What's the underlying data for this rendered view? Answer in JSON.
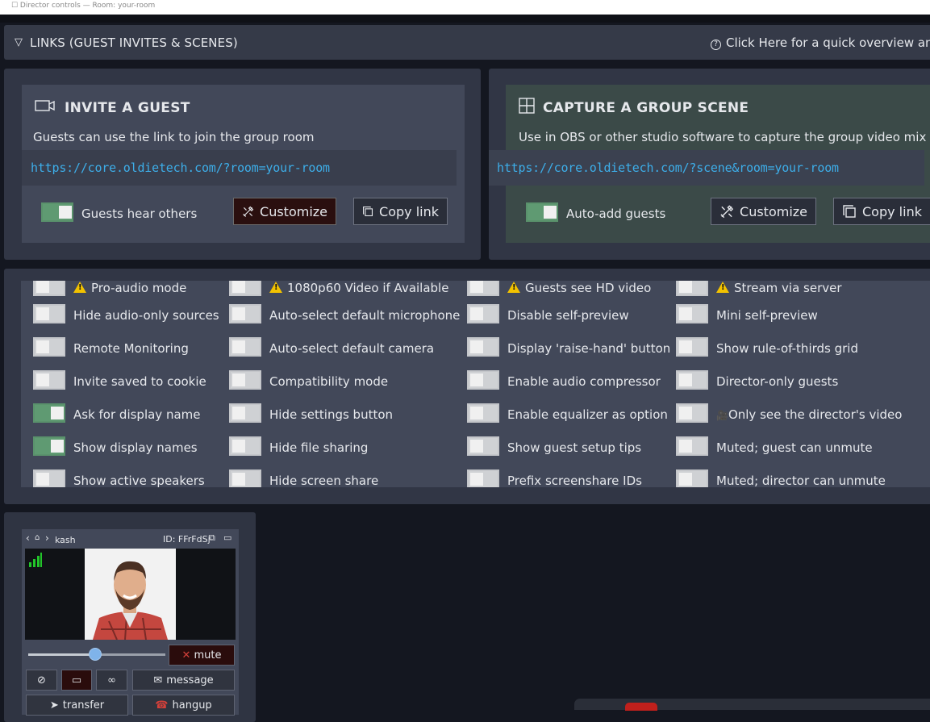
{
  "topbar": {
    "text": "☐ Director controls — Room: your-room"
  },
  "links_header": {
    "title": "LINKS (GUEST INVITES & SCENES)",
    "help": "Click Here for a quick overview and"
  },
  "guest": {
    "title": "INVITE A GUEST",
    "desc": "Guests can use the link to join the group room",
    "url": "https://core.oldietech.com/?room=your-room",
    "toggle_label": "Guests hear others",
    "customize": "Customize",
    "copy": "Copy link"
  },
  "scene": {
    "title": "CAPTURE A GROUP SCENE",
    "desc": "Use in OBS or other studio software to capture the group video mix",
    "url": "https://core.oldietech.com/?scene&room=your-room",
    "toggle_label": "Auto-add guests",
    "customize": "Customize",
    "copy": "Copy link"
  },
  "options": {
    "col1": [
      {
        "label": "Pro-audio mode",
        "on": false,
        "warn": true
      },
      {
        "label": "Hide audio-only sources",
        "on": false
      },
      {
        "label": "Remote Monitoring",
        "on": false
      },
      {
        "label": "Invite saved to cookie",
        "on": false
      },
      {
        "label": "Ask for display name",
        "on": true
      },
      {
        "label": "Show display names",
        "on": true
      },
      {
        "label": "Show active speakers",
        "on": false
      }
    ],
    "col2": [
      {
        "label": "1080p60 Video if Available",
        "on": false,
        "warn": true
      },
      {
        "label": "Auto-select default microphone",
        "on": false
      },
      {
        "label": "Auto-select default camera",
        "on": false
      },
      {
        "label": "Compatibility mode",
        "on": false
      },
      {
        "label": "Hide settings button",
        "on": false
      },
      {
        "label": "Hide file sharing",
        "on": false
      },
      {
        "label": "Hide screen share",
        "on": false
      }
    ],
    "col3": [
      {
        "label": "Guests see HD video",
        "on": false,
        "warn": true
      },
      {
        "label": "Disable self-preview",
        "on": false
      },
      {
        "label": "Display 'raise-hand' button",
        "on": false
      },
      {
        "label": "Enable audio compressor",
        "on": false
      },
      {
        "label": "Enable equalizer as option",
        "on": false
      },
      {
        "label": "Show guest setup tips",
        "on": false
      },
      {
        "label": "Prefix screenshare IDs",
        "on": false
      }
    ],
    "col4": [
      {
        "label": "Stream via server",
        "on": false,
        "warn": true
      },
      {
        "label": "Mini self-preview",
        "on": false
      },
      {
        "label": "Show rule-of-thirds grid",
        "on": false
      },
      {
        "label": "Director-only guests",
        "on": false
      },
      {
        "label": "Only see the director's video",
        "on": false,
        "icon": true
      },
      {
        "label": "Muted; guest can unmute",
        "on": false
      },
      {
        "label": "Muted; director can unmute",
        "on": false
      }
    ]
  },
  "video_card": {
    "name": "kash",
    "id": "ID: FFrFdSj",
    "mute": "mute",
    "message": "message",
    "transfer": "transfer",
    "hangup": "hangup"
  },
  "colors": {
    "accent_link": "#3daee9",
    "toggle_on": "#5f9a72",
    "warning": "#f2c200"
  }
}
